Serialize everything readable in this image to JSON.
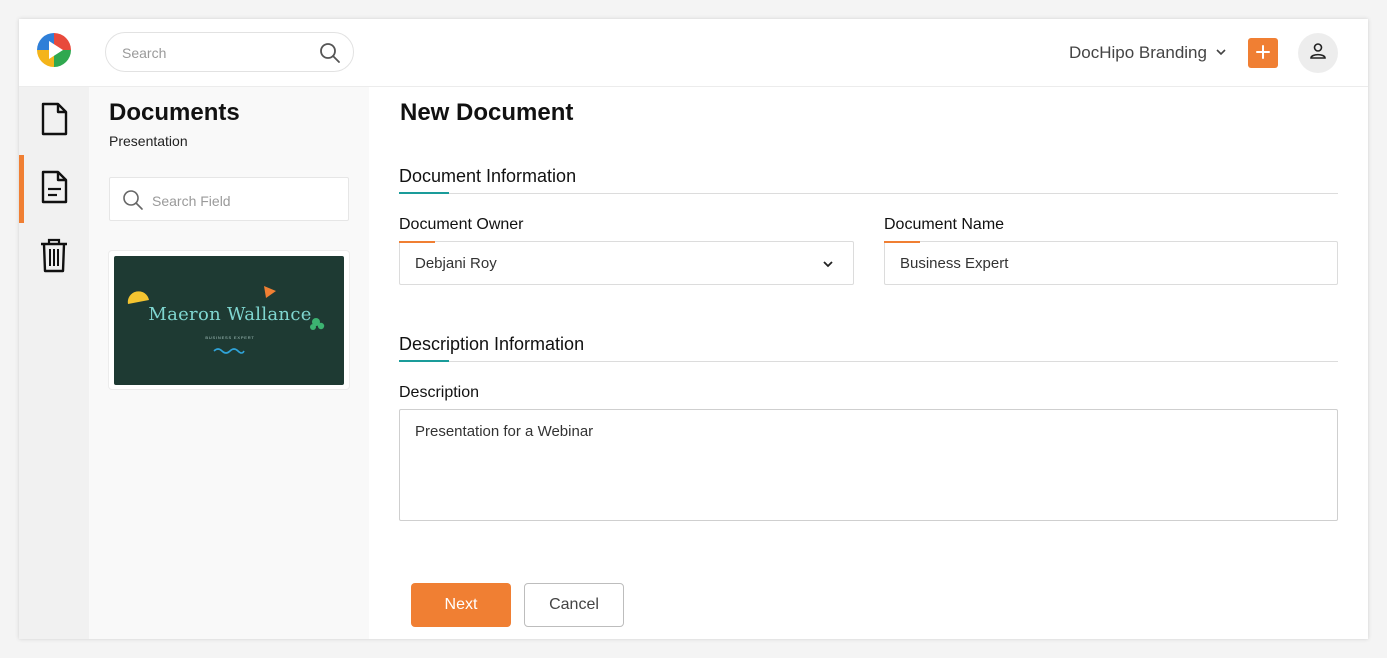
{
  "header": {
    "search_placeholder": "Search",
    "workspace_label": "DocHipo Branding",
    "logo_icon": "dochipo-logo-icon",
    "add_icon": "plus-icon",
    "profile_icon": "user-icon"
  },
  "rail": {
    "items": [
      {
        "icon": "file-icon",
        "active": false
      },
      {
        "icon": "document-text-icon",
        "active": true
      },
      {
        "icon": "trash-icon",
        "active": false
      }
    ]
  },
  "panel": {
    "title": "Documents",
    "subtitle": "Presentation",
    "search_placeholder": "Search Field",
    "thumbnail": {
      "name": "Maeron Wallance",
      "role": "BUSINESS EXPERT"
    }
  },
  "main": {
    "title": "New Document",
    "document_info": {
      "heading": "Document Information",
      "owner_label": "Document Owner",
      "owner_value": "Debjani Roy",
      "name_label": "Document Name",
      "name_value": "Business Expert"
    },
    "description_info": {
      "heading": "Description Information",
      "description_label": "Description",
      "description_value": "Presentation for a Webinar"
    },
    "next_label": "Next",
    "cancel_label": "Cancel"
  },
  "colors": {
    "accent": "#f07f33",
    "teal": "#1a9c9a",
    "thumbnail_bg": "#1e3a33"
  }
}
